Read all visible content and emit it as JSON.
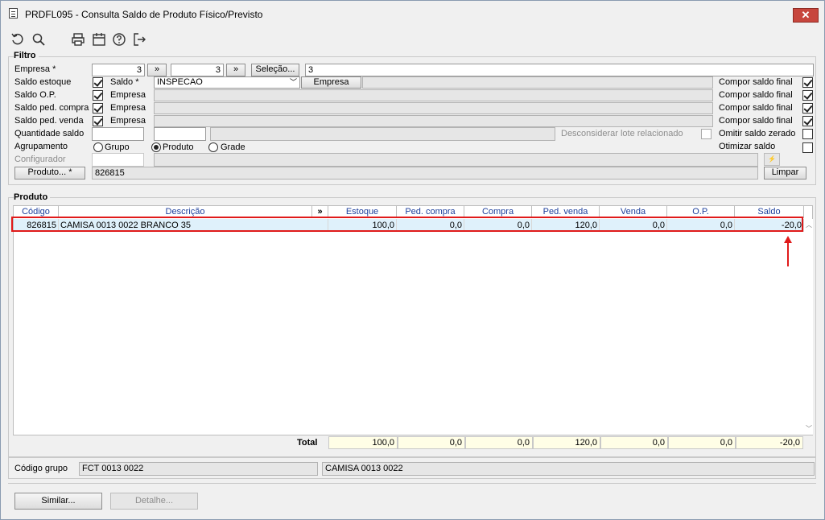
{
  "window": {
    "title": "PRDFL095 - Consulta Saldo de Produto Físico/Previsto",
    "close_label": "✕"
  },
  "toolbar": {
    "icons": [
      "refresh-icon",
      "search-icon",
      "print-icon",
      "calendar-icon",
      "help-icon",
      "exit-icon"
    ]
  },
  "filtro": {
    "title": "Filtro",
    "empresa_label": "Empresa *",
    "empresa_from": "3",
    "empresa_to": "3",
    "range_button": "»",
    "range_button2": "»",
    "selecao_button": "Seleção...",
    "selecao_value": "3",
    "saldo_estoque_label": "Saldo estoque",
    "saldo_label": "Saldo *",
    "saldo_value": "INSPECAO",
    "empresa_button": "Empresa",
    "saldo_op_label": "Saldo O.P.",
    "saldo_ped_compra_label": "Saldo ped. compra",
    "saldo_ped_venda_label": "Saldo ped. venda",
    "empresa_text": "Empresa",
    "compor_label": "Compor saldo final",
    "quantidade_label": "Quantidade saldo",
    "desconsiderar_label": "Desconsiderar lote relacionado",
    "omitir_label": "Omitir saldo zerado",
    "agrupamento_label": "Agrupamento",
    "grupo_label": "Grupo",
    "produto_label": "Produto",
    "grade_label": "Grade",
    "otimizar_label": "Otimizar saldo",
    "configurador_label": "Configurador",
    "produto_button": "Produto... *",
    "produto_value": "826815",
    "limpar_button": "Limpar"
  },
  "produto": {
    "title": "Produto",
    "columns": {
      "codigo": "Código",
      "descricao": "Descrição",
      "expand": "»",
      "estoque": "Estoque",
      "ped_compra": "Ped. compra",
      "compra": "Compra",
      "ped_venda": "Ped. venda",
      "venda": "Venda",
      "op": "O.P.",
      "saldo": "Saldo"
    },
    "row": {
      "codigo": "826815",
      "descricao": "CAMISA 0013 0022 BRANCO  35",
      "estoque": "100,0",
      "ped_compra": "0,0",
      "compra": "0,0",
      "ped_venda": "120,0",
      "venda": "0,0",
      "op": "0,0",
      "saldo": "-20,0"
    },
    "total_label": "Total",
    "totals": {
      "estoque": "100,0",
      "ped_compra": "0,0",
      "compra": "0,0",
      "ped_venda": "120,0",
      "venda": "0,0",
      "op": "0,0",
      "saldo": "-20,0"
    }
  },
  "codigo_grupo": {
    "label": "Código grupo",
    "code": "FCT 0013 0022",
    "description": "CAMISA 0013 0022"
  },
  "footer": {
    "similar_button": "Similar...",
    "detalhe_button": "Detalhe..."
  },
  "colors": {
    "highlight_box": "#e01a1a",
    "selected_row": "#dff1fb",
    "header_text": "#1d3f9c",
    "total_cell": "#fffee6"
  }
}
